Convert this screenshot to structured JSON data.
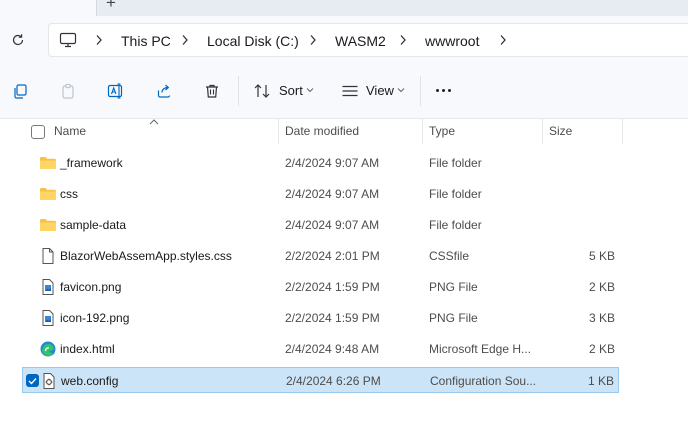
{
  "tabs": {
    "new_tab_glyph": "+"
  },
  "address": {
    "crumbs": [
      "This PC",
      "Local Disk (C:)",
      "WASM2",
      "wwwroot"
    ]
  },
  "toolbar": {
    "sort_label": "Sort",
    "view_label": "View"
  },
  "columns": {
    "name": "Name",
    "date": "Date modified",
    "type": "Type",
    "size": "Size"
  },
  "files": [
    {
      "name": "_framework",
      "date": "2/4/2024 9:07 AM",
      "type": "File folder",
      "size": "",
      "icon": "folder-icon"
    },
    {
      "name": "css",
      "date": "2/4/2024 9:07 AM",
      "type": "File folder",
      "size": "",
      "icon": "folder-icon"
    },
    {
      "name": "sample-data",
      "date": "2/4/2024 9:07 AM",
      "type": "File folder",
      "size": "",
      "icon": "folder-icon"
    },
    {
      "name": "BlazorWebAssemApp.styles.css",
      "date": "2/2/2024 2:01 PM",
      "type": "CSSfile",
      "size": "5 KB",
      "icon": "document-icon"
    },
    {
      "name": "favicon.png",
      "date": "2/2/2024 1:59 PM",
      "type": "PNG File",
      "size": "2 KB",
      "icon": "image-file-icon"
    },
    {
      "name": "icon-192.png",
      "date": "2/2/2024 1:59 PM",
      "type": "PNG File",
      "size": "3 KB",
      "icon": "image-file-icon"
    },
    {
      "name": "index.html",
      "date": "2/4/2024 9:48 AM",
      "type": "Microsoft Edge H...",
      "size": "2 KB",
      "icon": "edge-icon"
    },
    {
      "name": "web.config",
      "date": "2/4/2024 6:26 PM",
      "type": "Configuration Sou...",
      "size": "1 KB",
      "icon": "config-file-icon",
      "selected": true
    }
  ],
  "colors": {
    "selection_bg": "#cce4f7",
    "selection_border": "#99c9ef",
    "accent": "#0067c0",
    "folder": "#f4c247"
  }
}
